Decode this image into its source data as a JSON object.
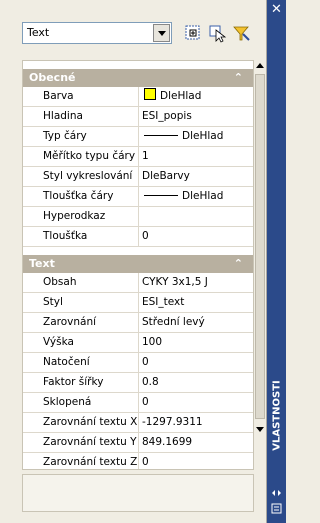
{
  "toolbar": {
    "object_type": "Text"
  },
  "sections": {
    "general": {
      "title": "Obecné",
      "rows": [
        {
          "label": "Barva",
          "value": "DleHlad"
        },
        {
          "label": "Hladina",
          "value": "ESI_popis"
        },
        {
          "label": "Typ čáry",
          "value": "DleHlad"
        },
        {
          "label": "Měřítko typu čáry",
          "value": "1"
        },
        {
          "label": "Styl vykreslování",
          "value": "DleBarvy"
        },
        {
          "label": "Tloušťka čáry",
          "value": "DleHlad"
        },
        {
          "label": "Hyperodkaz",
          "value": ""
        },
        {
          "label": "Tloušťka",
          "value": "0"
        }
      ]
    },
    "text": {
      "title": "Text",
      "rows": [
        {
          "label": "Obsah",
          "value": "CYKY 3x1,5 J"
        },
        {
          "label": "Styl",
          "value": "ESI_text"
        },
        {
          "label": "Zarovnání",
          "value": "Střední levý"
        },
        {
          "label": "Výška",
          "value": "100"
        },
        {
          "label": "Natočení",
          "value": "0"
        },
        {
          "label": "Faktor šířky",
          "value": "0.8"
        },
        {
          "label": "Sklopená",
          "value": "0"
        },
        {
          "label": "Zarovnání textu X",
          "value": "-1297.9311"
        },
        {
          "label": "Zarovnání textu Y",
          "value": "849.1699"
        },
        {
          "label": "Zarovnání textu Z",
          "value": "0"
        }
      ]
    }
  },
  "sidebar": {
    "title": "VLASTNOSTI"
  },
  "colors": {
    "header_bg": "#b8b0a0",
    "side_bg": "#2b4a8a",
    "color_swatch": "#ffff00"
  }
}
